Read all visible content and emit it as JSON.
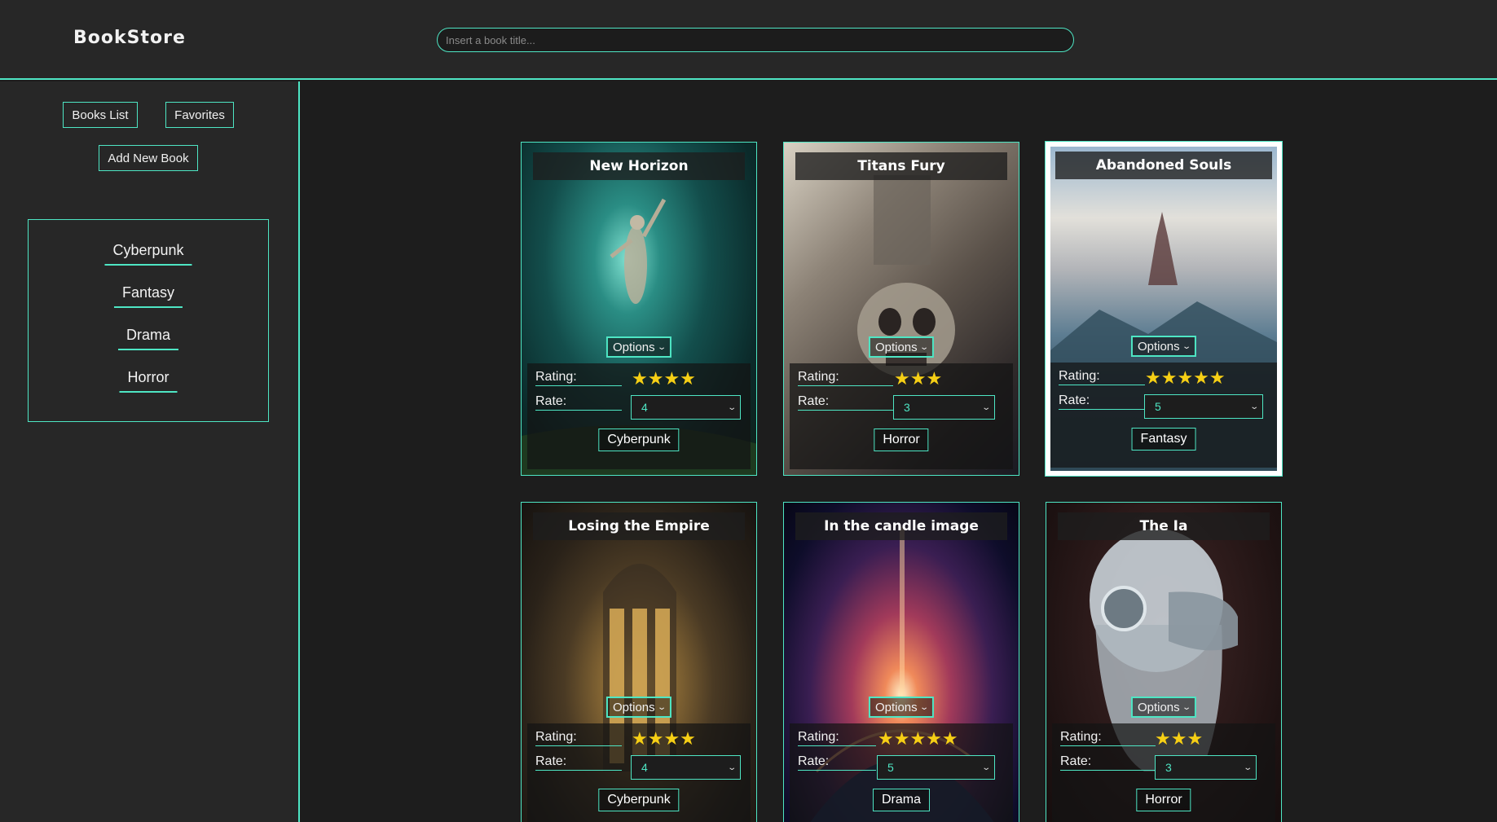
{
  "header": {
    "brand": "BookStore",
    "search_placeholder": "Insert a book title..."
  },
  "sidebar": {
    "books_list_label": "Books List",
    "favorites_label": "Favorites",
    "add_new_label": "Add New Book",
    "genres": [
      "Cyberpunk",
      "Fantasy",
      "Drama",
      "Horror"
    ]
  },
  "labels": {
    "options": "Options",
    "rating": "Rating:",
    "rate": "Rate:"
  },
  "books": [
    {
      "title": "New Horizon",
      "stars": "★★★★",
      "rate": "4",
      "genre": "Cyberpunk"
    },
    {
      "title": "Titans Fury",
      "stars": "★★★",
      "rate": "3",
      "genre": "Horror"
    },
    {
      "title": "Abandoned Souls",
      "stars": "★★★★★",
      "rate": "5",
      "genre": "Fantasy"
    },
    {
      "title": "Losing the Empire",
      "stars": "★★★★",
      "rate": "4",
      "genre": "Cyberpunk"
    },
    {
      "title": "In the candle image",
      "stars": "★★★★★",
      "rate": "5",
      "genre": "Drama"
    },
    {
      "title": "The Ia",
      "stars": "★★★",
      "rate": "3",
      "genre": "Horror"
    }
  ],
  "colors": {
    "accent": "#4ee6c4",
    "star": "#f6cf15",
    "header_bg": "#272727",
    "page_bg": "#1d1d1d"
  }
}
